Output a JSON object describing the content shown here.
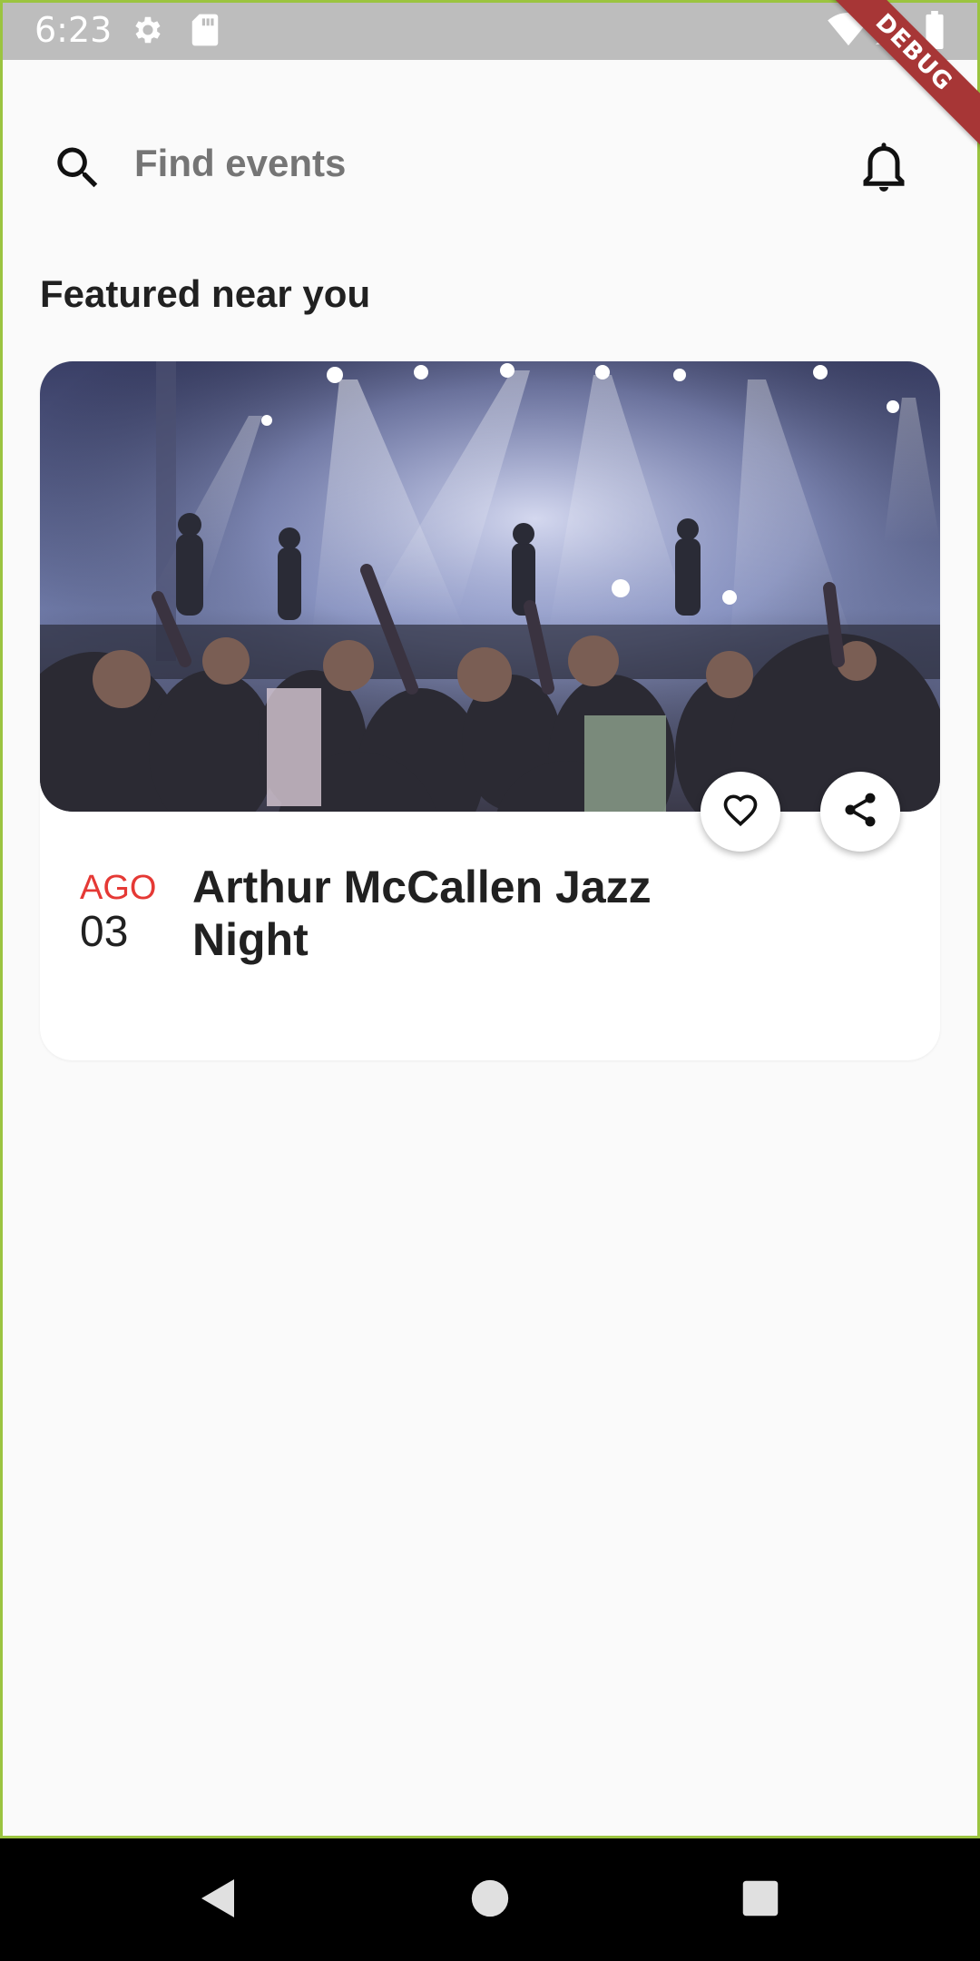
{
  "status_bar": {
    "time": "6:23",
    "icons": [
      "settings-icon",
      "sd-card-icon",
      "wifi-icon",
      "signal-icon",
      "battery-icon"
    ]
  },
  "debug_banner": "DEBUG",
  "header": {
    "search_placeholder": "Find events",
    "search_icon": "search-icon",
    "notification_icon": "bell-icon"
  },
  "featured": {
    "title": "Featured near you",
    "events": [
      {
        "month": "AGO",
        "day": "03",
        "title": "Arthur McCallen Jazz Night",
        "image": "concert crowd with stage lights",
        "actions": [
          "favorite-heart-icon",
          "share-icon"
        ]
      }
    ]
  },
  "nav_bar": {
    "buttons": [
      "back-triangle-icon",
      "home-circle-icon",
      "recents-square-icon"
    ]
  },
  "colors": {
    "status_bar": "#bdbdbd",
    "background": "#fafafa",
    "card": "#ffffff",
    "date_month": "#e53935",
    "text_primary": "#212121",
    "placeholder": "#757575",
    "debug_ribbon": "#a73636",
    "frame_border": "#9bc440"
  }
}
